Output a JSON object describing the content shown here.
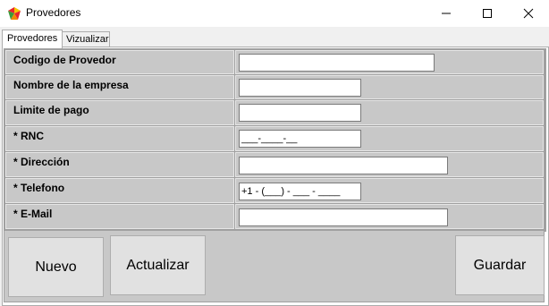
{
  "window": {
    "title": "Provedores"
  },
  "tabs": [
    {
      "label": "Provedores",
      "active": true
    },
    {
      "label": "Vizualizar",
      "active": false
    }
  ],
  "form": {
    "fields": [
      {
        "label": "Codigo de Provedor",
        "value": ""
      },
      {
        "label": "Nombre de la empresa",
        "value": ""
      },
      {
        "label": "Limite de pago",
        "value": ""
      },
      {
        "label": "* RNC",
        "value": "___-____-__"
      },
      {
        "label": "* Dirección",
        "value": ""
      },
      {
        "label": "* Telefono",
        "value": "+1 - (___) - ___ - ____"
      },
      {
        "label": "* E-Mail",
        "value": ""
      }
    ]
  },
  "buttons": {
    "nuevo": "Nuevo",
    "actualizar": "Actualizar",
    "guardar": "Guardar"
  }
}
